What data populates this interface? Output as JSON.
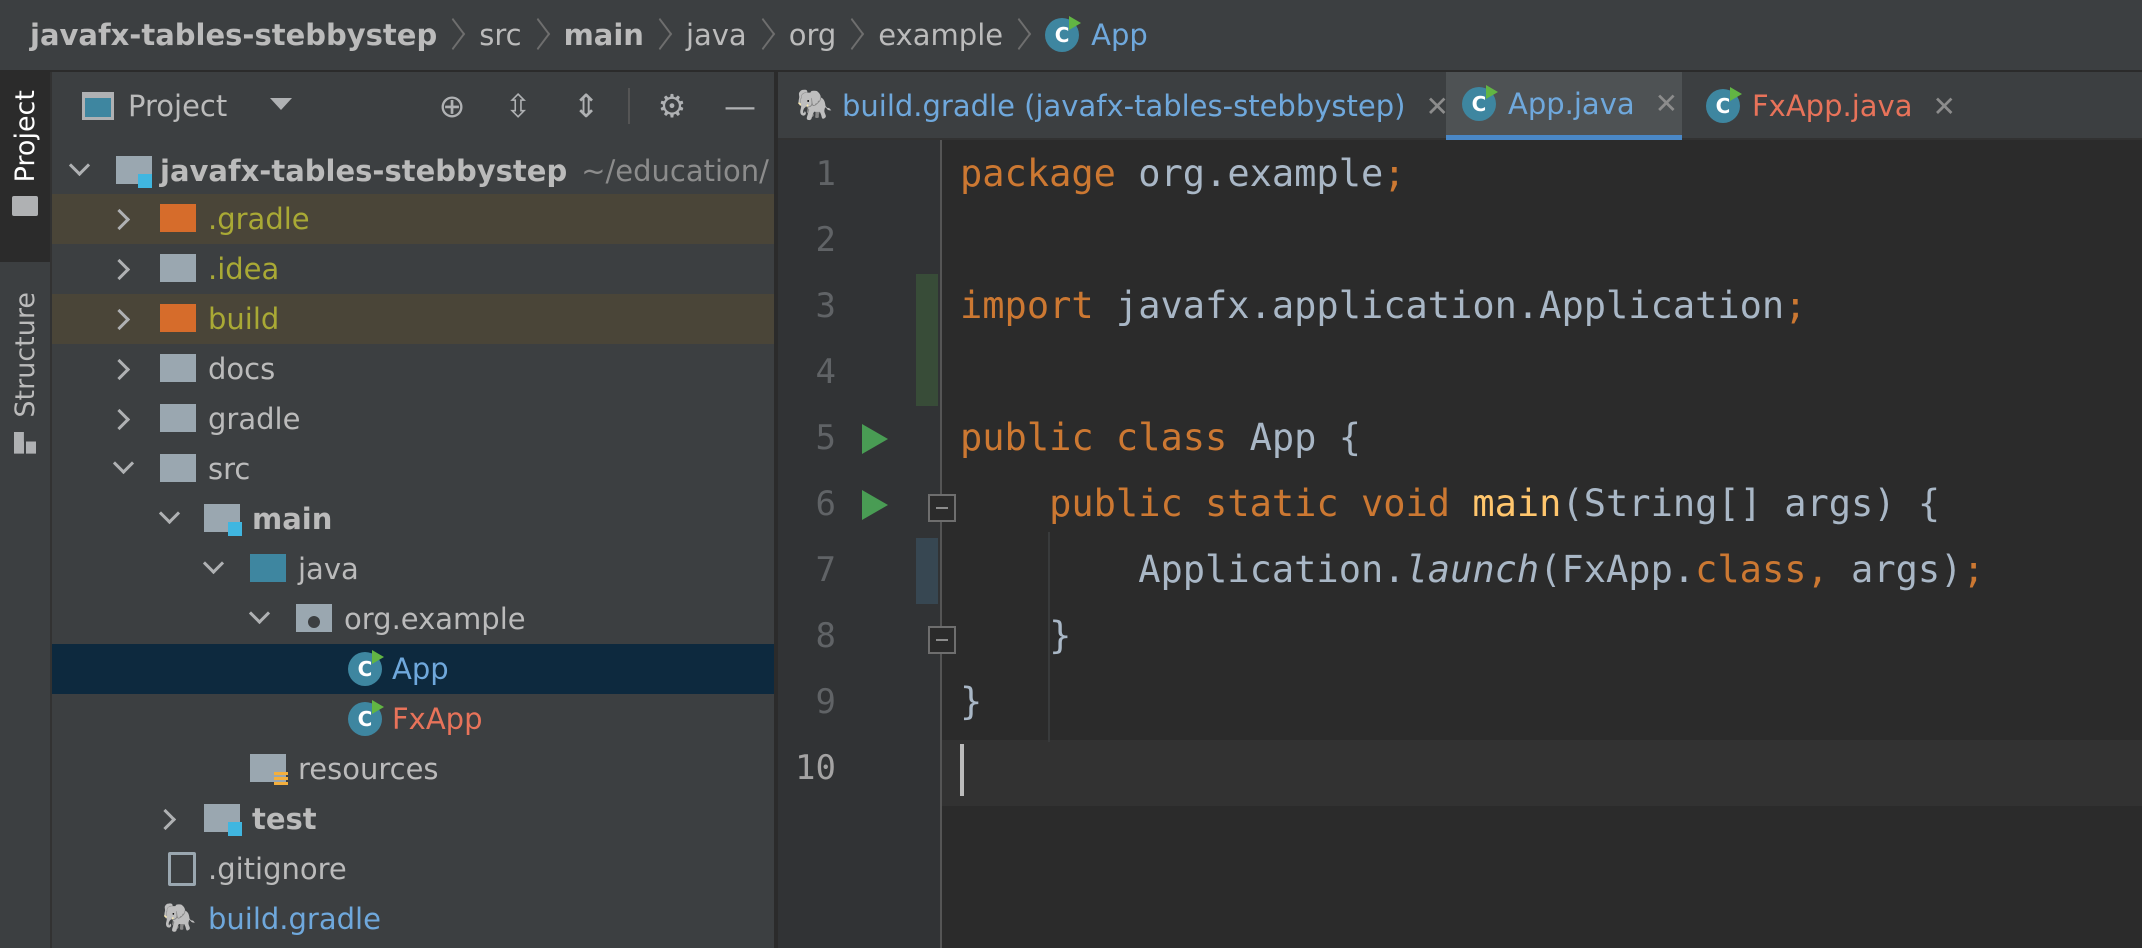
{
  "breadcrumb": {
    "items": [
      "javafx-tables-stebbystep",
      "src",
      "main",
      "java",
      "org",
      "example"
    ],
    "current": "App"
  },
  "tool_stripe": {
    "project_label": "Project",
    "structure_label": "Structure"
  },
  "project_panel": {
    "title": "Project",
    "tree": [
      {
        "label": "javafx-tables-stebbystep",
        "path": "~/education/"
      },
      {
        "label": ".gradle"
      },
      {
        "label": ".idea"
      },
      {
        "label": "build"
      },
      {
        "label": "docs"
      },
      {
        "label": "gradle"
      },
      {
        "label": "src"
      },
      {
        "label": "main"
      },
      {
        "label": "java"
      },
      {
        "label": "org.example"
      },
      {
        "label": "App"
      },
      {
        "label": "FxApp"
      },
      {
        "label": "resources"
      },
      {
        "label": "test"
      },
      {
        "label": ".gitignore"
      },
      {
        "label": "build.gradle"
      }
    ]
  },
  "editor_tabs": [
    {
      "label": "build.gradle (javafx-tables-stebbystep)",
      "active": false
    },
    {
      "label": "App.java",
      "active": true
    },
    {
      "label": "FxApp.java",
      "active": false
    }
  ],
  "editor": {
    "line_numbers": [
      "1",
      "2",
      "3",
      "4",
      "5",
      "6",
      "7",
      "8",
      "9",
      "10"
    ],
    "code": {
      "l1_kw": "package",
      "l1_rest": " org.example",
      "l1_semi": ";",
      "l3_kw": "import",
      "l3_rest": " javafx.application.Application",
      "l3_semi": ";",
      "l5_kw": "public class",
      "l5_rest": " App {",
      "l6_kw": "public static void",
      "l6_fn": " main",
      "l6_rest": "(String[] args) {",
      "l7_a": "Application.",
      "l7_it": "launch",
      "l7_b": "(FxApp.",
      "l7_kw": "class,",
      "l7_c": " args)",
      "l7_semi": ";",
      "l8": "}",
      "l9": "}"
    }
  },
  "colors": {
    "background": "#2b2b2b",
    "panel": "#3c3f41",
    "keyword": "#cc7832",
    "method": "#ffc66d",
    "identifier": "#a9b7c6",
    "selection": "#0d293e",
    "active_tab_underline": "#4a88c7",
    "run_icon": "#499c54"
  }
}
